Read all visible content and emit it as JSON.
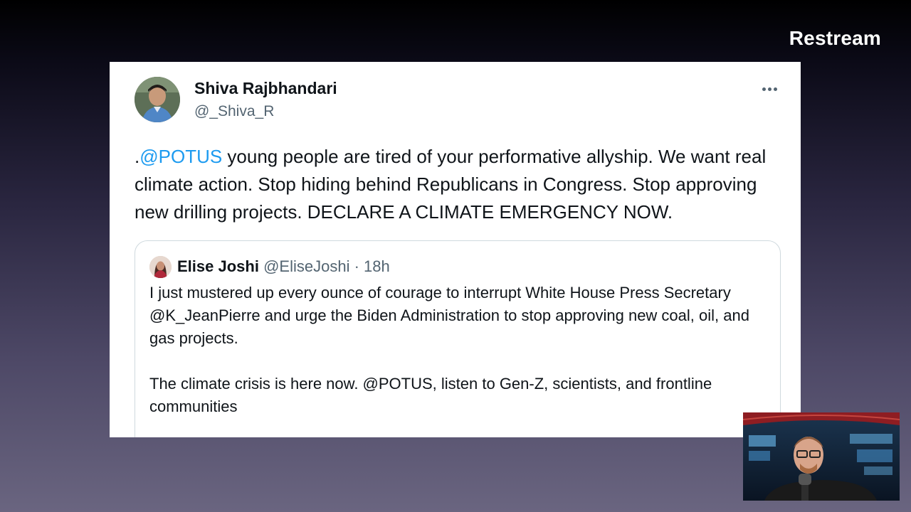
{
  "watermark": "Restream",
  "tweet": {
    "author_name": "Shiva Rajbhandari",
    "author_handle": "@_Shiva_R",
    "text_prefix": ".",
    "mention": "@POTUS",
    "text_body": " young people are tired of your performative allyship. We want real climate action. Stop hiding behind Republicans in Congress. Stop approving new drilling projects. DECLARE A CLIMATE EMERGENCY NOW."
  },
  "quoted_tweet": {
    "author_name": "Elise Joshi",
    "author_handle": "@EliseJoshi",
    "separator": "·",
    "time": "18h",
    "paragraph_1": "I just mustered up every ounce of courage to interrupt White House Press Secretary @K_JeanPierre and urge the Biden Administration to stop approving new coal, oil, and gas projects.",
    "paragraph_2": "The climate crisis is here now. @POTUS, listen to Gen-Z, scientists, and frontline communities"
  },
  "icons": {
    "more": "more-options-icon"
  },
  "colors": {
    "link": "#1d9bf0",
    "text": "#0f1419",
    "secondary_text": "#536471",
    "border": "#cfd9de"
  }
}
